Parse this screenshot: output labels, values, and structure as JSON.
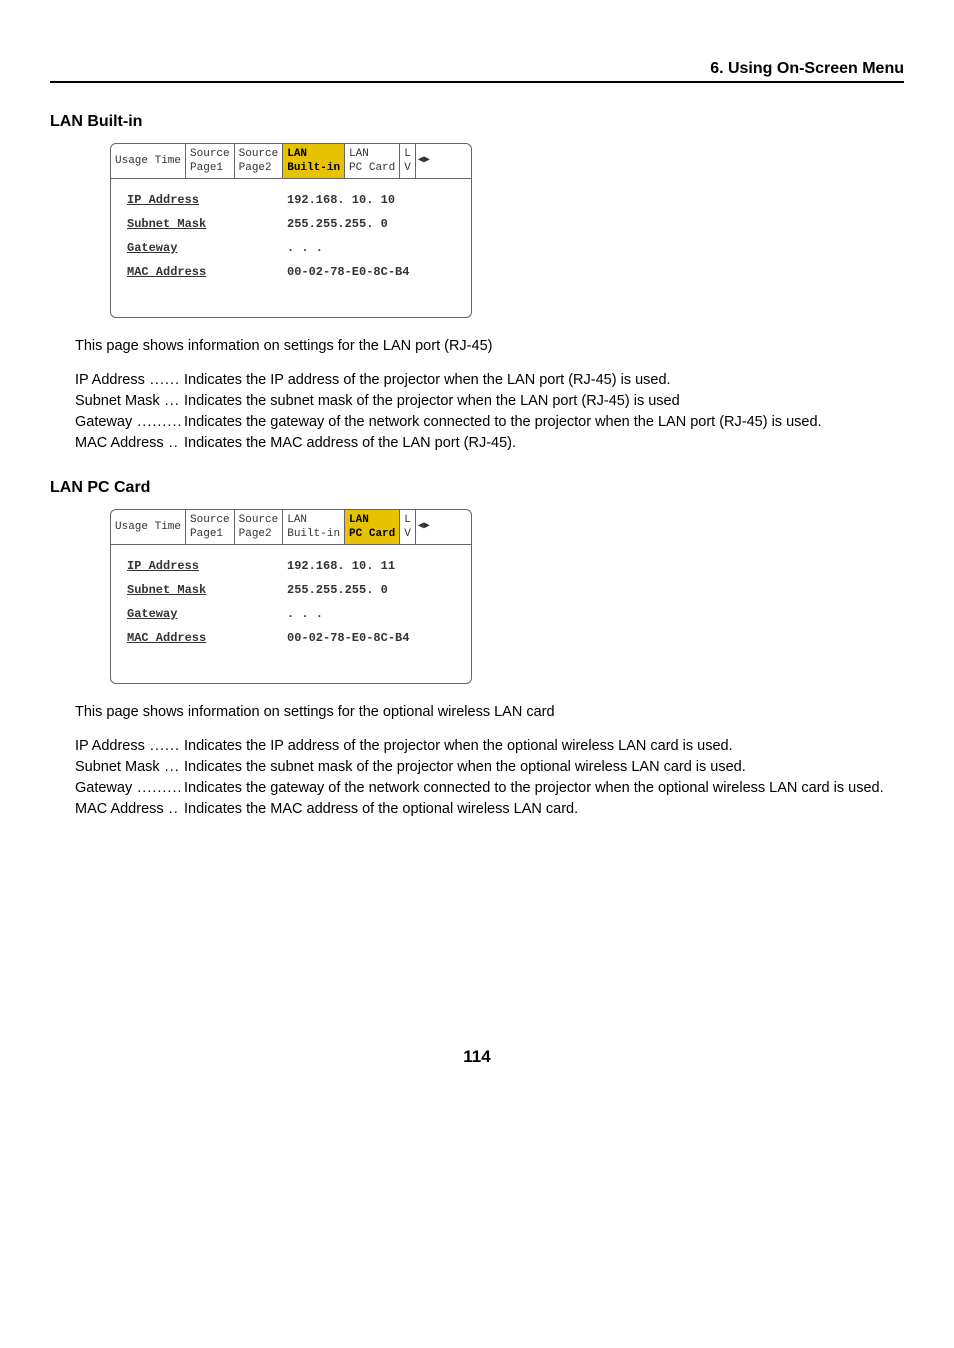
{
  "header": {
    "chapter": "6. Using On-Screen Menu"
  },
  "section1": {
    "title": "LAN Built-in",
    "tabs": {
      "t0": "Usage Time",
      "t1a": "Source",
      "t1b": "Page1",
      "t2a": "Source",
      "t2b": "Page2",
      "t3a": "LAN",
      "t3b": "Built-in",
      "t4a": "LAN",
      "t4b": "PC Card",
      "t5a": "L",
      "t5b": "V"
    },
    "labels": {
      "ip": "IP Address",
      "mask": "Subnet Mask",
      "gw": "Gateway",
      "mac": "MAC Address"
    },
    "values": {
      "ip": "192.168. 10. 10",
      "mask": "255.255.255.  0",
      "gw": "   .   .   .",
      "mac": "00-02-78-E0-8C-B4"
    },
    "desc": "This page shows information on settings for the LAN port (RJ-45)",
    "defs": {
      "ip": "Indicates the IP address of the projector when the LAN port (RJ-45) is used.",
      "mask": "Indicates the subnet mask of the projector when the LAN port (RJ-45) is used",
      "gw": "Indicates the gateway of the network connected to the projector when the LAN port (RJ-45) is used.",
      "mac": "Indicates the MAC address of the LAN port (RJ-45)."
    }
  },
  "section2": {
    "title": "LAN PC Card",
    "tabs": {
      "t0": "Usage Time",
      "t1a": "Source",
      "t1b": "Page1",
      "t2a": "Source",
      "t2b": "Page2",
      "t3a": "LAN",
      "t3b": "Built-in",
      "t4a": "LAN",
      "t4b": "PC Card",
      "t5a": "L",
      "t5b": "V"
    },
    "labels": {
      "ip": "IP Address",
      "mask": "Subnet Mask",
      "gw": "Gateway",
      "mac": "MAC Address"
    },
    "values": {
      "ip": "192.168. 10. 11",
      "mask": "255.255.255.  0",
      "gw": "   .   .   .",
      "mac": "00-02-78-E0-8C-B4"
    },
    "desc": "This page shows information on settings for the optional wireless LAN card",
    "defs": {
      "ip": "Indicates the IP address of the projector when the optional wireless LAN card is used.",
      "mask": "Indicates the subnet mask of the projector when the optional wireless LAN card is used.",
      "gw": "Indicates the gateway of the network connected to the projector when the optional wireless LAN card is used.",
      "mac": "Indicates the MAC address of the optional wireless LAN card."
    }
  },
  "terms": {
    "ip": "IP Address",
    "mask": "Subnet Mask",
    "gw": "Gateway",
    "mac": "MAC Address"
  },
  "pageNumber": "114"
}
